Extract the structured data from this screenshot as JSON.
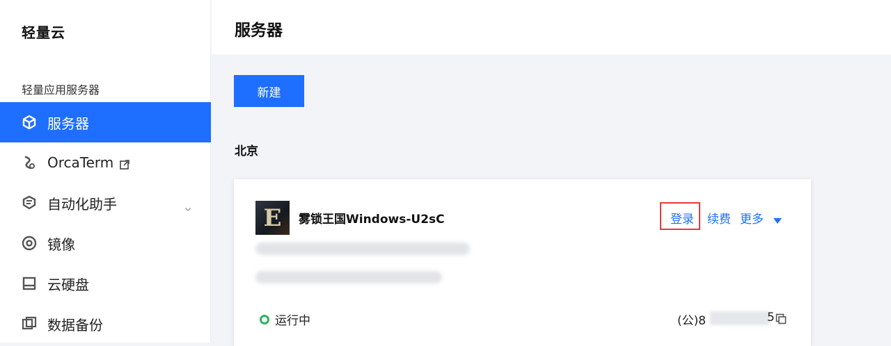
{
  "app": {
    "brand": "轻量云"
  },
  "sidebar": {
    "section_title": "轻量应用服务器",
    "items": [
      {
        "label": "服务器",
        "icon": "server-cube-icon",
        "active": true
      },
      {
        "label": "OrcaTerm",
        "icon": "orcaterm-icon",
        "external": true
      },
      {
        "label": "自动化助手",
        "icon": "automation-icon",
        "expandable": true
      },
      {
        "label": "镜像",
        "icon": "image-disc-icon"
      },
      {
        "label": "云硬盘",
        "icon": "cloud-disk-icon"
      },
      {
        "label": "数据备份",
        "icon": "backup-icon"
      }
    ]
  },
  "header": {
    "title": "服务器"
  },
  "toolbar": {
    "new_label": "新建"
  },
  "region": {
    "name": "北京"
  },
  "server_card": {
    "name": "雾锁王国Windows-U2sC",
    "thumb_letter": "E",
    "actions": {
      "login": "登录",
      "renew": "续费",
      "more": "更多"
    },
    "status": "运行中",
    "ip_prefix": "(公)8",
    "ip_suffix": "5"
  },
  "colors": {
    "accent": "#1e6fff",
    "status_running": "#2ab55e",
    "highlight_box": "#e53935"
  }
}
